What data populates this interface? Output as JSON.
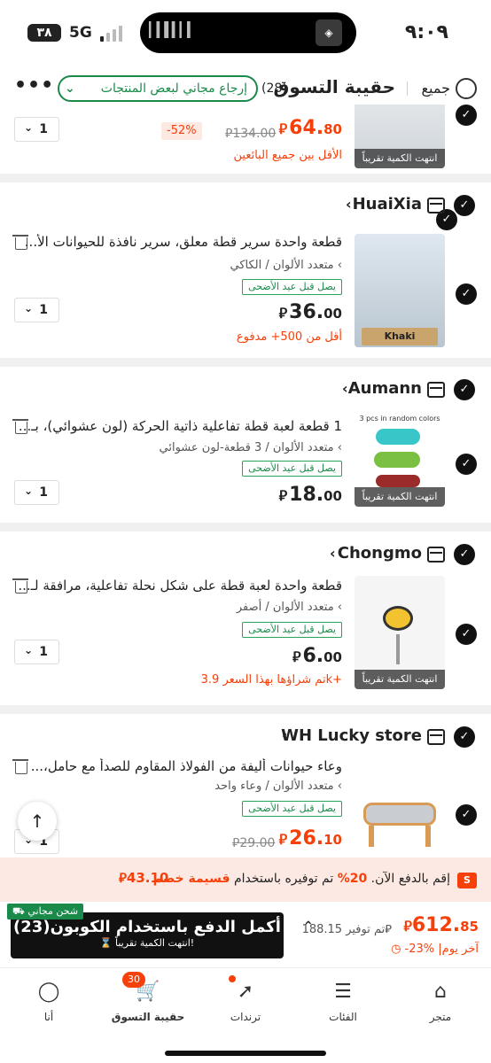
{
  "status_bar": {
    "time": "٩:٠٩",
    "network": "5G",
    "battery": "٣٨"
  },
  "header": {
    "title": "حقيبة التسوق",
    "count": "(28)",
    "select_all": "جميع",
    "free_returns": "إرجاع مجاني لبعض المنتجات",
    "more": "•••"
  },
  "items": [
    {
      "store": "",
      "title": "",
      "price_int": "64.",
      "price_dec": "80",
      "old_price": "134.00",
      "discount": "-52%",
      "note": "الأقل بين جميع البائعين",
      "qty": "1",
      "thumb_label": "انتهت الكمية تقريباً"
    },
    {
      "store": "HuaiXia",
      "title": "قطعة واحدة سرير قطة معلق، سرير نافذة للحيوانات الأ...",
      "variant": "متعدد الألوان / الكاكي",
      "badge": "يصل قبل عيد الأضحى",
      "price_int": "36.",
      "price_dec": "00",
      "note": "أقل من 500+ مدفوع",
      "qty": "1",
      "thumb_label": "Khaki"
    },
    {
      "store": "Aumann",
      "title": "1 قطعة لعبة قطة تفاعلية ذاتية الحركة (لون عشوائي)، بـ...",
      "variant": "متعدد الألوان / 3 قطعة-لون عشوائي",
      "badge": "يصل قبل عيد الأضحى",
      "price_int": "18.",
      "price_dec": "00",
      "qty": "1",
      "thumb_top": "3 pcs in random colors",
      "thumb_label": "انتهت الكمية تقريباً"
    },
    {
      "store": "Chongmo",
      "title": "قطعة واحدة لعبة قطة على شكل نحلة تفاعلية، مرافقة لـ...",
      "variant": "متعدد الألوان / أصفر",
      "badge": "يصل قبل عيد الأضحى",
      "price_int": "6.",
      "price_dec": "00",
      "note": "تم شراؤها بهذا السعر 3.9k+",
      "qty": "1",
      "thumb_label": "انتهت الكمية تقريباً"
    },
    {
      "store": "WH Lucky store",
      "title": "وعاء حيوانات أليفة من الفولاذ المقاوم للصدأ مع حامل،...",
      "variant": "متعدد الألوان / وعاء واحد",
      "badge": "يصل قبل عيد الأضحى",
      "price_int": "26.",
      "price_dec": "10",
      "old_price": "29.00",
      "qty": "1"
    }
  ],
  "currency_symbol": "⃁",
  "promo": {
    "text_before": "إقم بالدفع الآن. ",
    "percent": "20%",
    "text_mid": " تم توفيره باستخدام ",
    "coupon": "قسيمة خصم",
    "amount": "43.10"
  },
  "checkout": {
    "button": "أكمل الدفع باستخدام الكوبون(23)",
    "sub": "انتهت الكمية تقريباً!",
    "free_shipping": "شحن مجاني",
    "total_int": "612.",
    "total_dec": "85",
    "saved": "تم توفير 188.15",
    "last_day": "-23% |آخر يوم"
  },
  "tabs": [
    {
      "label": "متجر",
      "icon": "home-icon"
    },
    {
      "label": "الفئات",
      "icon": "categories-icon"
    },
    {
      "label": "ترندات",
      "icon": "trends-icon"
    },
    {
      "label": "حقيبة التسوق",
      "icon": "cart-icon",
      "badge": "30"
    },
    {
      "label": "أنا",
      "icon": "profile-icon"
    }
  ],
  "colors": {
    "accent": "#f6400a",
    "green": "#1a8a4a",
    "dark": "#111111"
  }
}
